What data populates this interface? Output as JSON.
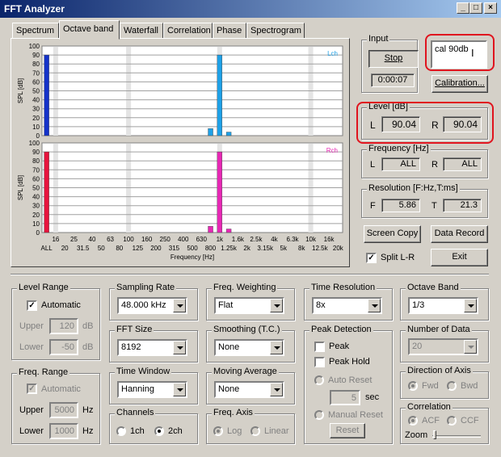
{
  "window": {
    "title": "FFT Analyzer"
  },
  "tabs": [
    "Spectrum",
    "Octave band",
    "Waterfall",
    "Correlation",
    "Phase",
    "Spectrogram"
  ],
  "active_tab": "Octave band",
  "chart_data": [
    {
      "type": "bar",
      "channel": "Lch",
      "color": "#1ea0e6",
      "all_color": "#1432c8",
      "ylabel": "SPL [dB]",
      "ylim": [
        0,
        100
      ],
      "yticks": [
        "0",
        "10",
        "20",
        "30",
        "40",
        "50",
        "60",
        "70",
        "80",
        "90",
        "100"
      ],
      "categories": [
        "ALL",
        "16",
        "20",
        "25",
        "31.5",
        "40",
        "50",
        "63",
        "80",
        "100",
        "125",
        "160",
        "200",
        "250",
        "315",
        "400",
        "500",
        "630",
        "800",
        "1k",
        "1.25k",
        "1.6k",
        "2k",
        "2.5k",
        "3.15k",
        "4k",
        "5k",
        "6.3k",
        "8k",
        "10k",
        "12.5k",
        "16k",
        "20k"
      ],
      "values": [
        90,
        0,
        0,
        0,
        0,
        0,
        0,
        0,
        0,
        0,
        0,
        0,
        0,
        0,
        0,
        0,
        0,
        0,
        8,
        90,
        4,
        0,
        0,
        0,
        0,
        0,
        0,
        0,
        0,
        0,
        0,
        0,
        0
      ]
    },
    {
      "type": "bar",
      "channel": "Rch",
      "color": "#e628b4",
      "all_color": "#e6143c",
      "ylabel": "SPL [dB]",
      "ylim": [
        0,
        100
      ],
      "yticks": [
        "0",
        "10",
        "20",
        "30",
        "40",
        "50",
        "60",
        "70",
        "80",
        "90",
        "100"
      ],
      "categories": [
        "ALL",
        "16",
        "20",
        "25",
        "31.5",
        "40",
        "50",
        "63",
        "80",
        "100",
        "125",
        "160",
        "200",
        "250",
        "315",
        "400",
        "500",
        "630",
        "800",
        "1k",
        "1.25k",
        "1.6k",
        "2k",
        "2.5k",
        "3.15k",
        "4k",
        "5k",
        "6.3k",
        "8k",
        "10k",
        "12.5k",
        "16k",
        "20k"
      ],
      "values": [
        90,
        0,
        0,
        0,
        0,
        0,
        0,
        0,
        0,
        0,
        0,
        0,
        0,
        0,
        0,
        0,
        0,
        0,
        7,
        90,
        4,
        0,
        0,
        0,
        0,
        0,
        0,
        0,
        0,
        0,
        0,
        0,
        0
      ]
    }
  ],
  "xlabels_top": [
    "16",
    "25",
    "40",
    "63",
    "100",
    "160",
    "250",
    "400",
    "630",
    "1k",
    "1.6k",
    "2.5k",
    "4k",
    "6.3k",
    "10k",
    "16k"
  ],
  "xlabels_bottom": [
    "ALL",
    "20",
    "31.5",
    "50",
    "80",
    "125",
    "200",
    "315",
    "500",
    "800",
    "1.25k",
    "2k",
    "3.15k",
    "5k",
    "8k",
    "12.5k",
    "20k"
  ],
  "xlabel": "Frequency [Hz]",
  "input": {
    "title": "Input",
    "stop_label": "Stop",
    "time": "0:00:07"
  },
  "memo": "cal 90db",
  "calibration_label": "Calibration...",
  "level": {
    "title": "Level [dB]",
    "l_label": "L",
    "l_value": "90.04",
    "r_label": "R",
    "r_value": "90.04"
  },
  "frequency": {
    "title": "Frequency [Hz]",
    "l_label": "L",
    "l_value": "ALL",
    "r_label": "R",
    "r_value": "ALL"
  },
  "resolution": {
    "title": "Resolution [F:Hz,T:ms]",
    "f_label": "F",
    "f_value": "5.86",
    "t_label": "T",
    "t_value": "21.3"
  },
  "buttons": {
    "screen_copy": "Screen Copy",
    "data_record": "Data Record",
    "split": "Split L-R",
    "exit": "Exit"
  },
  "level_range": {
    "title": "Level Range",
    "automatic": "Automatic",
    "upper_label": "Upper",
    "upper": "120",
    "lower_label": "Lower",
    "lower": "-50",
    "unit": "dB"
  },
  "freq_range": {
    "title": "Freq. Range",
    "automatic": "Automatic",
    "upper_label": "Upper",
    "upper": "5000",
    "lower_label": "Lower",
    "lower": "1000",
    "unit": "Hz"
  },
  "sampling_rate": {
    "title": "Sampling Rate",
    "value": "48.000 kHz"
  },
  "fft_size": {
    "title": "FFT Size",
    "value": "8192"
  },
  "time_window": {
    "title": "Time Window",
    "value": "Hanning"
  },
  "channels": {
    "title": "Channels",
    "opt1": "1ch",
    "opt2": "2ch"
  },
  "freq_weighting": {
    "title": "Freq. Weighting",
    "value": "Flat"
  },
  "smoothing": {
    "title": "Smoothing (T.C.)",
    "value": "None"
  },
  "moving_average": {
    "title": "Moving Average",
    "value": "None"
  },
  "freq_axis": {
    "title": "Freq. Axis",
    "opt1": "Log",
    "opt2": "Linear"
  },
  "time_resolution": {
    "title": "Time Resolution",
    "value": "8x"
  },
  "peak_detection": {
    "title": "Peak Detection",
    "peak": "Peak",
    "peak_hold": "Peak Hold",
    "auto_reset": "Auto Reset",
    "sec_value": "5",
    "sec": "sec",
    "manual_reset": "Manual Reset",
    "reset": "Reset"
  },
  "octave_band": {
    "title": "Octave Band",
    "value": "1/3"
  },
  "number_of_data": {
    "title": "Number of Data",
    "value": "20"
  },
  "direction": {
    "title": "Direction of Axis",
    "opt1": "Fwd",
    "opt2": "Bwd"
  },
  "correlation": {
    "title": "Correlation",
    "opt1": "ACF",
    "opt2": "CCF",
    "zoom": "Zoom"
  }
}
